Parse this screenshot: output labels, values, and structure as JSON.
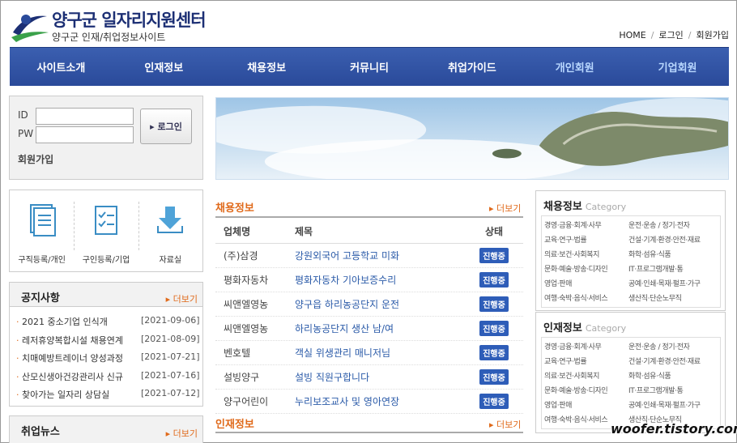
{
  "header": {
    "title": "양구군 일자리지원센터",
    "subtitle": "양구군 인재/취업정보사이트",
    "links": [
      "HOME",
      "로그인",
      "회원가입"
    ]
  },
  "nav": [
    "사이트소개",
    "인재정보",
    "채용정보",
    "커뮤니티",
    "취업가이드",
    "개인회원",
    "기업회원"
  ],
  "login": {
    "id_label": "ID",
    "pw_label": "PW",
    "id_value": "",
    "pw_value": "",
    "button": "▸ 로그인",
    "join": "회원가입"
  },
  "quick_links": [
    {
      "label": "구직등록/개인",
      "icon": "document-icon"
    },
    {
      "label": "구인등록/기업",
      "icon": "checklist-icon"
    },
    {
      "label": "자료실",
      "icon": "download-icon"
    }
  ],
  "notice": {
    "title": "공지사항",
    "more": "▸ 더보기",
    "items": [
      {
        "title": "2021 중소기업 인식개",
        "date": "[2021-09-06]"
      },
      {
        "title": "레저휴양복합시설 채용연계",
        "date": "[2021-08-09]"
      },
      {
        "title": "치매예방트레이너 양성과정",
        "date": "[2021-07-21]"
      },
      {
        "title": "산모신생아건강관리사 신규",
        "date": "[2021-07-16]"
      },
      {
        "title": "찾아가는 일자리 상담실",
        "date": "[2021-07-12]"
      }
    ]
  },
  "news": {
    "title": "취업뉴스",
    "more": "▸ 더보기"
  },
  "jobs": {
    "title": "채용정보",
    "more": "▸ 더보기",
    "headers": [
      "업체명",
      "제목",
      "상태"
    ],
    "rows": [
      {
        "company": "(주)삼경",
        "title": "강원외국어 고등학교 미화",
        "status": "진행중"
      },
      {
        "company": "평화자동차",
        "title": "평화자동차 기아보증수리",
        "status": "진행중"
      },
      {
        "company": "씨앤엘영농",
        "title": "양구읍 하리농공단지 운전",
        "status": "진행중"
      },
      {
        "company": "씨앤엘영농",
        "title": "하리농공단지 생산 남/여",
        "status": "진행중"
      },
      {
        "company": "벤호텔",
        "title": "객실 위생관리 매니저님",
        "status": "진행중"
      },
      {
        "company": "설빙양구",
        "title": "설빙 직원구합니다",
        "status": "진행중"
      },
      {
        "company": "양구어린이",
        "title": "누리보조교사 및 영아연장",
        "status": "진행중"
      }
    ]
  },
  "talent": {
    "title": "인재정보",
    "more": "▸ 더보기"
  },
  "categories": {
    "label": "Category",
    "job_title": "채용정보",
    "talent_title": "인재정보",
    "items": [
      "경영·금융·회계·사무",
      "운전·운송 / 정기·전자",
      "교육·연구·법률",
      "건설·기계·환경·안전·재료",
      "의료·보건·사회복지",
      "화학·섬유·식품",
      "문화·예술·방송·디자인",
      "IT·프로그램개발·통",
      "영업·판매",
      "공예·인쇄·목재·펄프·가구",
      "여행·숙박·음식·서비스",
      "생산직·단순노무직"
    ]
  },
  "watermark": "woofer.tistory.com",
  "colors": {
    "nav": "#2a4a9a",
    "accent": "#e06a1b",
    "link": "#2a5aa8",
    "badge": "#2e5db8"
  }
}
